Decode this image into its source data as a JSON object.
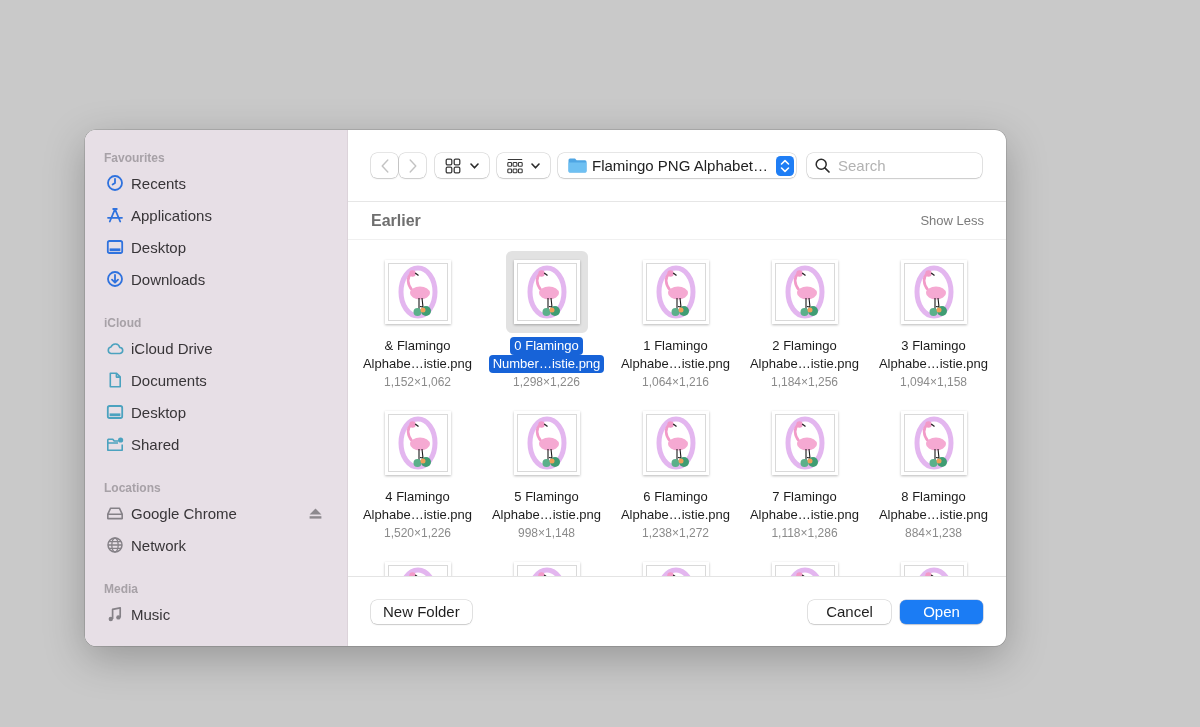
{
  "sidebar": {
    "sections": [
      {
        "title": "Favourites",
        "color": "#2f72de",
        "items": [
          {
            "label": "Recents",
            "kind": "recents",
            "ejectable": false
          },
          {
            "label": "Applications",
            "kind": "applications",
            "ejectable": false
          },
          {
            "label": "Desktop",
            "kind": "desktop",
            "ejectable": false
          },
          {
            "label": "Downloads",
            "kind": "downloads",
            "ejectable": false
          }
        ]
      },
      {
        "title": "iCloud",
        "color": "#4ba2bf",
        "items": [
          {
            "label": "iCloud Drive",
            "kind": "cloud",
            "ejectable": false
          },
          {
            "label": "Documents",
            "kind": "document",
            "ejectable": false
          },
          {
            "label": "Desktop",
            "kind": "desktop",
            "ejectable": false
          },
          {
            "label": "Shared",
            "kind": "shared",
            "ejectable": false
          }
        ]
      },
      {
        "title": "Locations",
        "color": "#858187",
        "items": [
          {
            "label": "Google Chrome",
            "kind": "drive",
            "ejectable": true
          },
          {
            "label": "Network",
            "kind": "network",
            "ejectable": false
          }
        ]
      },
      {
        "title": "Media",
        "color": "#858187",
        "items": [
          {
            "label": "Music",
            "kind": "music",
            "ejectable": false
          }
        ]
      }
    ]
  },
  "toolbar": {
    "nav": [
      {
        "kind": "back",
        "disabled": true
      },
      {
        "kind": "forward",
        "disabled": true
      }
    ],
    "location": "Flamingo PNG Alphabet…",
    "search": {
      "placeholder": "Search"
    }
  },
  "section": {
    "title": "Earlier",
    "action": "Show Less"
  },
  "files": [
    {
      "kind": "file",
      "name_lines": [
        "& Flamingo",
        "Alphabe…istie.png"
      ],
      "dimensions": "1,152×1,062",
      "selected": false
    },
    {
      "kind": "file",
      "name_lines": [
        "0 Flamingo",
        "Number…istie.png"
      ],
      "dimensions": "1,298×1,226",
      "selected": true
    },
    {
      "kind": "file",
      "name_lines": [
        "1 Flamingo",
        "Alphabe…istie.png"
      ],
      "dimensions": "1,064×1,216",
      "selected": false
    },
    {
      "kind": "file",
      "name_lines": [
        "2 Flamingo",
        "Alphabe…istie.png"
      ],
      "dimensions": "1,184×1,256",
      "selected": false
    },
    {
      "kind": "file",
      "name_lines": [
        "3 Flamingo",
        "Alphabe…istie.png"
      ],
      "dimensions": "1,094×1,158",
      "selected": false
    },
    {
      "kind": "file",
      "name_lines": [
        "4 Flamingo",
        "Alphabe…istie.png"
      ],
      "dimensions": "1,520×1,226",
      "selected": false
    },
    {
      "kind": "file",
      "name_lines": [
        "5 Flamingo",
        "Alphabe…istie.png"
      ],
      "dimensions": "998×1,148",
      "selected": false
    },
    {
      "kind": "file",
      "name_lines": [
        "6 Flamingo",
        "Alphabe…istie.png"
      ],
      "dimensions": "1,238×1,272",
      "selected": false
    },
    {
      "kind": "file",
      "name_lines": [
        "7 Flamingo",
        "Alphabe…istie.png"
      ],
      "dimensions": "1,118×1,286",
      "selected": false
    },
    {
      "kind": "file",
      "name_lines": [
        "8 Flamingo",
        "Alphabe…istie.png"
      ],
      "dimensions": "884×1,238",
      "selected": false
    },
    {
      "kind": "cut-off",
      "selected": false
    },
    {
      "kind": "cut-off",
      "selected": false
    },
    {
      "kind": "cut-off",
      "selected": false
    },
    {
      "kind": "cut-off",
      "selected": false
    },
    {
      "kind": "cut-off",
      "selected": false
    }
  ],
  "footer": {
    "new_folder": "New Folder",
    "buttons": [
      {
        "label": "Cancel",
        "default": false
      },
      {
        "label": "Open",
        "default": true
      }
    ]
  }
}
